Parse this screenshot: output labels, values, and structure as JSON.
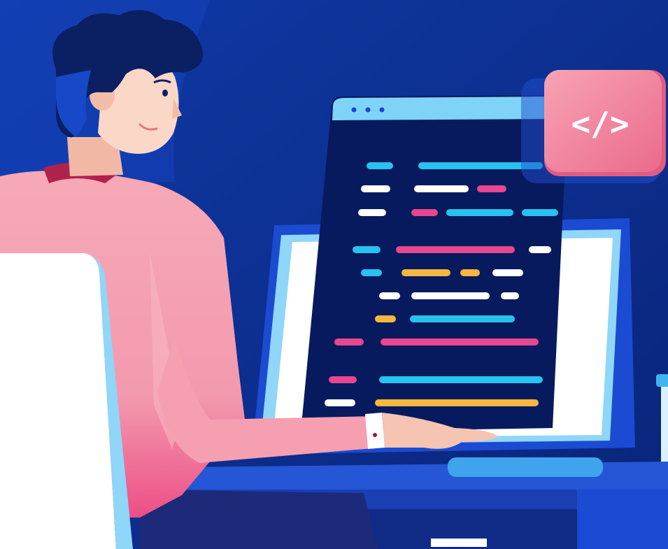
{
  "scene": {
    "title": "",
    "code_badge": {
      "symbol": "</>",
      "icon": "code-icon"
    },
    "colors": {
      "background": "#0c2a8a",
      "background_light": "#1a47c9",
      "screen": "#0c1f6e",
      "screen_bar": "#7fd3f7",
      "badge": "#f0879e",
      "shirt": "#f6a4b4",
      "hair": "#0b1f63",
      "skin": "#f7c9b8",
      "chair": "#ffffff",
      "desk": "#1c52d4"
    },
    "code_line_colors": {
      "cyan": "#27c2ef",
      "white": "#ffffff",
      "pink": "#e8468f",
      "yellow": "#f5b73f"
    }
  }
}
